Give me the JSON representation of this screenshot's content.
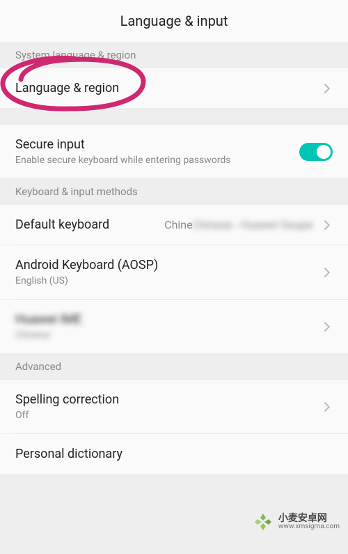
{
  "header": {
    "title": "Language & input"
  },
  "sections": {
    "system_language": {
      "header": "System language & region",
      "language_region": {
        "title": "Language & region"
      }
    },
    "secure_input": {
      "title": "Secure input",
      "subtitle": "Enable secure keyboard while entering passwords",
      "toggle_on": true
    },
    "keyboard_methods": {
      "header": "Keyboard & input methods",
      "default_keyboard": {
        "title": "Default keyboard",
        "value": "Chinese - Huawei Swype"
      },
      "android_keyboard": {
        "title": "Android Keyboard (AOSP)",
        "subtitle": "English (US)"
      },
      "blurred_keyboard": {
        "title": "Huawei IME",
        "subtitle": "Chinese"
      }
    },
    "advanced": {
      "header": "Advanced",
      "spelling": {
        "title": "Spelling correction",
        "subtitle": "Off"
      },
      "dictionary": {
        "title": "Personal dictionary"
      }
    }
  },
  "watermark": {
    "title": "小麦安卓网",
    "url": "www.xmsigma.com"
  }
}
